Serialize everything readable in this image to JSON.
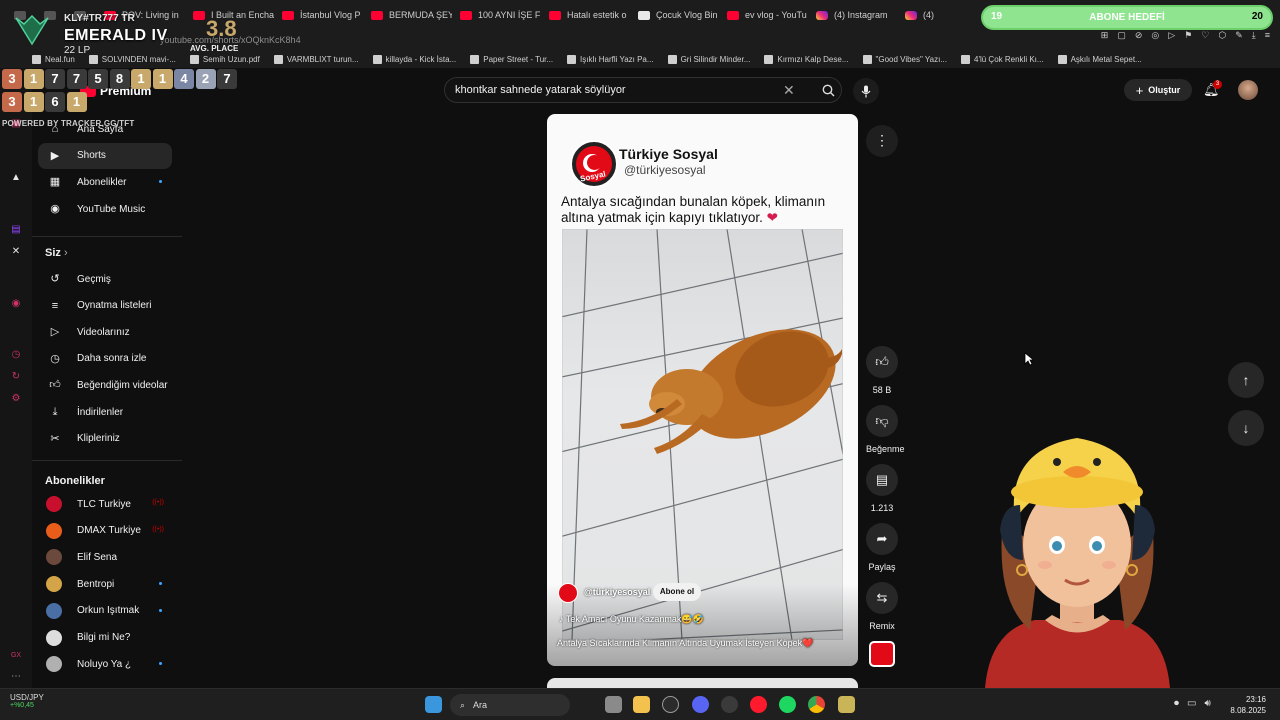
{
  "browser": {
    "tabs": [
      {
        "label": "",
        "icon": "gx-tab-icon"
      },
      {
        "label": "",
        "icon": "tab-icon"
      },
      {
        "label": "",
        "icon": "tab-icon"
      },
      {
        "label": "POV: Living in",
        "icon": "youtube-icon"
      },
      {
        "label": "I Built an Encha",
        "icon": "youtube-icon"
      },
      {
        "label": "İstanbul Vlog P",
        "icon": "youtube-icon"
      },
      {
        "label": "BERMUDA ŞEY",
        "icon": "youtube-icon"
      },
      {
        "label": "100 AYNI İŞE F",
        "icon": "youtube-icon"
      },
      {
        "label": "Hatalı estetik o",
        "icon": "youtube-icon"
      },
      {
        "label": "Çocuk Vlog Bin",
        "icon": "doc-icon"
      },
      {
        "label": "ev vlog - YouTu",
        "icon": "youtube-icon"
      },
      {
        "label": "(4) Instagram",
        "icon": "instagram-icon"
      },
      {
        "label": "(4)",
        "icon": "instagram-icon"
      }
    ],
    "url": "youtube.com/shorts/xOQknKcK8h4",
    "bookmarks": [
      "Neal.fun",
      "SOLVINDEN mavi-...",
      "Semih Uzun.pdf",
      "VARMBLIXT turun...",
      "killayda - Kick İsta...",
      "Paper Street - Tur...",
      "Işıklı Harfli Yazı Pa...",
      "Gri Silindir Minder...",
      "Kırmızı Kalp Dese...",
      "\"Good Vibes\" Yazı...",
      "4'lü Çok Renkli Kı...",
      "Aşkılı Metal Sepet..."
    ]
  },
  "tracker": {
    "name": "KLY#TR777 TR",
    "rank": "EMERALD IV",
    "lp": "22 LP",
    "avg_value": "3.8",
    "avg_label": "AVG. PLACE",
    "placements": [
      "3",
      "1",
      "7",
      "7",
      "5",
      "8",
      "1",
      "1",
      "4",
      "2",
      "7",
      "3",
      "1",
      "6",
      "1"
    ],
    "powered_by": "POWERED BY TRACKER.GG/TFT"
  },
  "goal": {
    "left": "19",
    "title": "ABONE HEDEFİ",
    "right": "20"
  },
  "youtube": {
    "premium_label": "Premium",
    "search_value": "khontkar sahnede yatarak söylüyor",
    "create_label": "Oluştur",
    "notif_count": "3",
    "nav_main": [
      {
        "label": "Ana Sayfa",
        "icon": "home-icon"
      },
      {
        "label": "Shorts",
        "icon": "shorts-icon"
      },
      {
        "label": "Abonelikler",
        "icon": "subscriptions-icon"
      },
      {
        "label": "YouTube Music",
        "icon": "youtube-music-icon"
      }
    ],
    "siz_header": "Siz",
    "nav_you": [
      {
        "label": "Geçmiş",
        "icon": "history-icon"
      },
      {
        "label": "Oynatma listeleri",
        "icon": "playlists-icon"
      },
      {
        "label": "Videolarınız",
        "icon": "your-videos-icon"
      },
      {
        "label": "Daha sonra izle",
        "icon": "watch-later-icon"
      },
      {
        "label": "Beğendiğim videolar",
        "icon": "liked-icon"
      },
      {
        "label": "İndirilenler",
        "icon": "downloads-icon"
      },
      {
        "label": "Klipleriniz",
        "icon": "clips-icon"
      }
    ],
    "subs_header": "Abonelikler",
    "subscriptions": [
      {
        "label": "TLC Turkiye",
        "color": "#c8102e",
        "marker": "live"
      },
      {
        "label": "DMAX Turkiye",
        "color": "#e85d1a",
        "marker": "live"
      },
      {
        "label": "Elif Sena",
        "color": "#6b4a3d",
        "marker": "none"
      },
      {
        "label": "Bentropi",
        "color": "#d4a548",
        "marker": "dot"
      },
      {
        "label": "Orkun Işıtmak",
        "color": "#4a6fa5",
        "marker": "dot"
      },
      {
        "label": "Bilgi mi Ne?",
        "color": "#dddddd",
        "marker": "none"
      },
      {
        "label": "Noluyo Ya ¿",
        "color": "#b0b0b0",
        "marker": "dot"
      }
    ]
  },
  "short": {
    "channel_name": "Türkiye Sosyal",
    "channel_handle": "@türkiyesosyal",
    "caption": "Antalya sıcağından bunalan köpek, klimanın altına yatmak için kapıyı tıklatıyor.",
    "caption_emoji": "❤",
    "logo_text": "Sosyal",
    "overlay_handle": "@türkiyesosyal",
    "subscribe_label": "Abone ol",
    "sound_label": "Tek Amacı Oyunu Kazanmak😅🤣",
    "video_title": "Antalya Sıcaklarında Klimanın Altında Uyumak İsteyen Köpek❤️",
    "likes": "58 B",
    "dislike_label": "Beğenme",
    "comments": "1.213",
    "share_label": "Paylaş",
    "remix_label": "Remix"
  },
  "taskbar": {
    "ticker_name": "USD/JPY",
    "ticker_change": "+%0,45",
    "search_label": "Ara",
    "time": "23:16",
    "date": "8.08.2025"
  },
  "colors": {
    "accent": "#ff0033",
    "bg": "#0f0f0f",
    "goal": "#8fe58f"
  }
}
